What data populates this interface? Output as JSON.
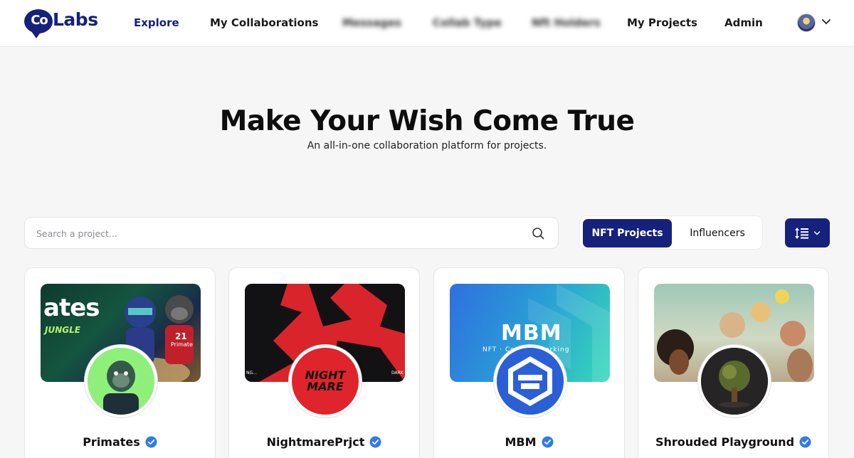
{
  "brand": {
    "logo_co": "Co",
    "logo_labs": "Labs",
    "color": "#16217c"
  },
  "nav": {
    "items": [
      {
        "label": "Explore",
        "active": true
      },
      {
        "label": "My Collaborations"
      },
      {
        "label": "Messages",
        "blurred": true
      },
      {
        "label": "Collab Type",
        "blurred": true
      },
      {
        "label": "Nft Holders",
        "blurred": true
      },
      {
        "label": "My Projects"
      },
      {
        "label": "Admin"
      }
    ],
    "user_menu_icon": "chevron-down-icon"
  },
  "hero": {
    "title": "Make Your Wish Come True",
    "subtitle": "An all-in-one collaboration platform for projects."
  },
  "search": {
    "placeholder": "Search a project...",
    "value": ""
  },
  "filter": {
    "options": [
      "NFT Projects",
      "Influencers"
    ],
    "selected": "NFT Projects"
  },
  "sort": {
    "icon": "sort-icon"
  },
  "projects": [
    {
      "name": "Primates",
      "verified": true,
      "banner_text": "ates",
      "banner_sub": "JUNGLE",
      "badge": "21",
      "badge_label": "Primate"
    },
    {
      "name": "NightmarePrjct",
      "verified": true,
      "avatar_text": "NIGHT MARE",
      "banner_left": "NG...",
      "banner_right": "DARK"
    },
    {
      "name": "MBM",
      "verified": true,
      "banner_text": "MBM",
      "banner_sub": "NFT · Co... Networking"
    },
    {
      "name": "Shrouded Playground",
      "verified": true
    }
  ],
  "colors": {
    "accent": "#16217c",
    "verified": "#2f7be8",
    "bg": "#f6f6f7"
  }
}
